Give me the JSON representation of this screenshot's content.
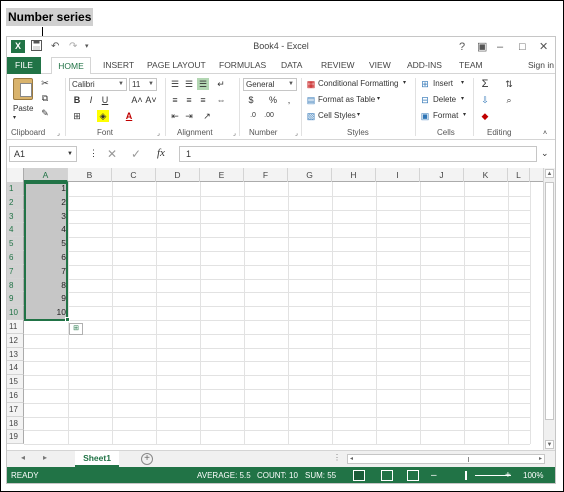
{
  "caption": "Number series",
  "app": {
    "title": "Book4 - Excel",
    "logo": "X",
    "qat": {
      "save_icon": "save-icon",
      "undo": "↶",
      "redo": "↷"
    },
    "window_controls": {
      "help": "?",
      "restore_ribbon": "▣",
      "minimize": "–",
      "maximize": "□",
      "close": "✕"
    },
    "sign_in": "Sign in"
  },
  "tabs": [
    "FILE",
    "HOME",
    "INSERT",
    "PAGE LAYOUT",
    "FORMULAS",
    "DATA",
    "REVIEW",
    "VIEW",
    "ADD-INS",
    "TEAM"
  ],
  "ribbon": {
    "clipboard": {
      "paste": "Paste",
      "label": "Clipboard"
    },
    "font": {
      "name": "Calibri",
      "size": "11",
      "bold": "B",
      "italic": "I",
      "underline": "U",
      "grow": "A˄",
      "shrink": "A˅",
      "label": "Font"
    },
    "alignment": {
      "label": "Alignment"
    },
    "number": {
      "format": "General",
      "currency": "$",
      "percent": "%",
      "comma": ",",
      "label": "Number"
    },
    "styles": {
      "conditional": "Conditional Formatting",
      "format_table": "Format as Table",
      "cell_styles": "Cell Styles",
      "label": "Styles"
    },
    "cells": {
      "insert": "Insert",
      "delete": "Delete",
      "format": "Format",
      "label": "Cells"
    },
    "editing": {
      "autosum": "Σ",
      "label": "Editing"
    }
  },
  "formula_bar": {
    "name_box": "A1",
    "cancel": "✕",
    "enter": "✓",
    "fx": "fx",
    "value": "1"
  },
  "columns": [
    "A",
    "B",
    "C",
    "D",
    "E",
    "F",
    "G",
    "H",
    "I",
    "J",
    "K",
    "L"
  ],
  "rows": [
    "1",
    "2",
    "3",
    "4",
    "5",
    "6",
    "7",
    "8",
    "9",
    "10",
    "11",
    "12",
    "13",
    "14",
    "15",
    "16",
    "17",
    "18",
    "19"
  ],
  "cells_a": [
    "1",
    "2",
    "3",
    "4",
    "5",
    "6",
    "7",
    "8",
    "9",
    "10"
  ],
  "sheet": {
    "name": "Sheet1",
    "add": "+"
  },
  "status": {
    "ready": "READY",
    "average": "AVERAGE: 5.5",
    "count": "COUNT: 10",
    "sum": "SUM: 55",
    "zoom": "100%",
    "zoom_minus": "–",
    "zoom_plus": "+"
  },
  "colors": {
    "accent": "#217346",
    "selection": "#c6c6c6"
  }
}
